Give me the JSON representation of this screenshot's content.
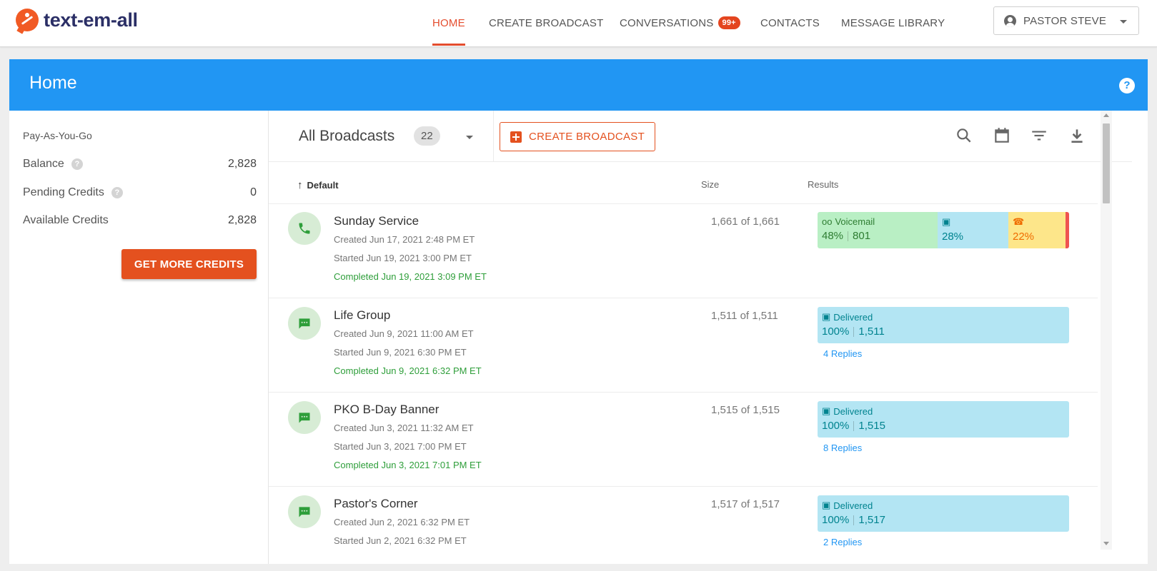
{
  "brand": {
    "name": "text-em-all"
  },
  "nav": {
    "items": [
      {
        "label": "HOME",
        "active": true
      },
      {
        "label": "CREATE BROADCAST"
      },
      {
        "label": "CONVERSATIONS",
        "badge": "99+"
      },
      {
        "label": "CONTACTS"
      },
      {
        "label": "MESSAGE LIBRARY"
      }
    ],
    "user": "PASTOR STEVE"
  },
  "header": {
    "title": "Home",
    "help_icon": "?"
  },
  "account": {
    "plan": "Pay-As-You-Go",
    "rows": [
      {
        "label": "Balance",
        "value": "2,828",
        "help": "?"
      },
      {
        "label": "Pending Credits",
        "value": "0",
        "help": "?"
      },
      {
        "label": "Available Credits",
        "value": "2,828"
      }
    ],
    "get_credits_label": "GET MORE CREDITS"
  },
  "toolbar": {
    "list_title": "All Broadcasts",
    "count": "22",
    "create_label": "CREATE BROADCAST",
    "icons": [
      "search-icon",
      "calendar-icon",
      "filter-icon",
      "download-icon"
    ]
  },
  "columns": {
    "sort": "Default",
    "size": "Size",
    "results": "Results"
  },
  "broadcasts": [
    {
      "name": "Sunday Service",
      "type": "phone",
      "created": "Created Jun 17, 2021 2:48 PM ET",
      "started": "Started Jun 19, 2021 3:00 PM ET",
      "completed": "Completed Jun 19, 2021 3:09 PM ET",
      "size": "1,661 of 1,661",
      "results": {
        "voicemail_label": "Voicemail",
        "voicemail_pct": "48%",
        "voicemail_count": "801",
        "live_pct": "28%",
        "noanswer_pct": "22%"
      }
    },
    {
      "name": "Life Group",
      "type": "text",
      "created": "Created Jun 9, 2021 11:00 AM ET",
      "started": "Started Jun 9, 2021 6:30 PM ET",
      "completed": "Completed Jun 9, 2021 6:32 PM ET",
      "size": "1,511 of 1,511",
      "results": {
        "label": "Delivered",
        "pct": "100%",
        "count": "1,511"
      },
      "replies": "4 Replies"
    },
    {
      "name": "PKO B-Day Banner",
      "type": "text",
      "created": "Created Jun 3, 2021 11:32 AM ET",
      "started": "Started Jun 3, 2021 7:00 PM ET",
      "completed": "Completed Jun 3, 2021 7:01 PM ET",
      "size": "1,515 of 1,515",
      "results": {
        "label": "Delivered",
        "pct": "100%",
        "count": "1,515"
      },
      "replies": "8 Replies"
    },
    {
      "name": "Pastor's Corner",
      "type": "text",
      "created": "Created Jun 2, 2021 6:32 PM ET",
      "started": "Started Jun 2, 2021 6:32 PM ET",
      "size": "1,517 of 1,517",
      "results": {
        "label": "Delivered",
        "pct": "100%",
        "count": "1,517"
      },
      "replies": "2 Replies"
    }
  ],
  "colors": {
    "accent": "#e4511f",
    "header": "#2196f3",
    "completed": "#2e9e3a"
  }
}
